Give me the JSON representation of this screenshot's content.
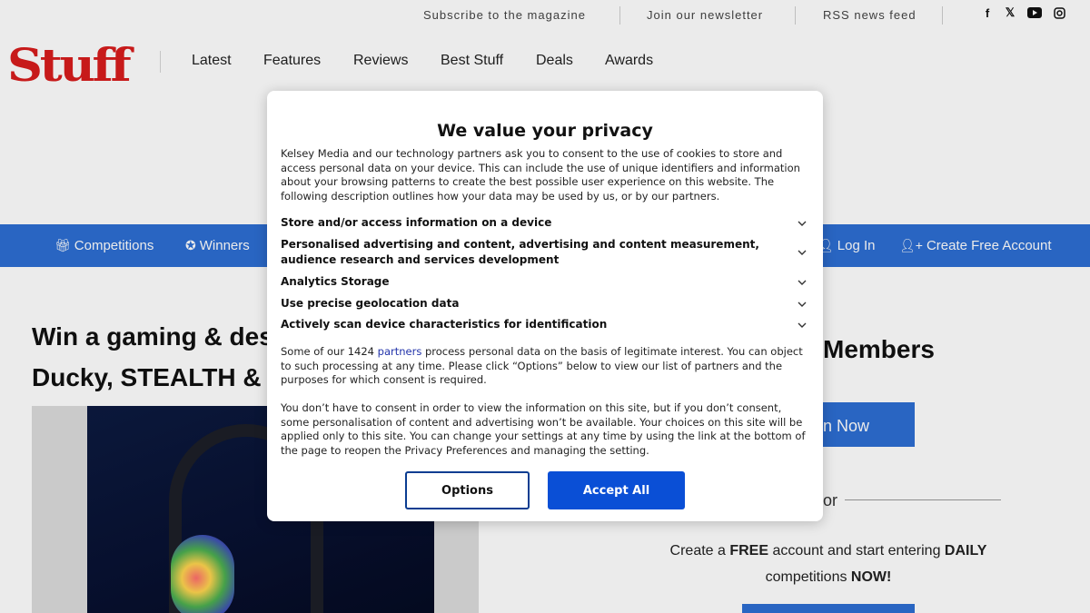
{
  "topbar": {
    "links": [
      "Subscribe to the magazine",
      "Join our newsletter",
      "RSS news feed"
    ],
    "social_icons": [
      "facebook-icon",
      "x-icon",
      "youtube-icon",
      "instagram-icon"
    ]
  },
  "logo": {
    "text": "Stuff"
  },
  "main_nav": [
    "Latest",
    "Features",
    "Reviews",
    "Best Stuff",
    "Deals",
    "Awards"
  ],
  "blue_nav": {
    "competitions": "Competitions",
    "winners": "Winners",
    "login": "Log In",
    "create_account": "Create Free Account"
  },
  "article": {
    "title": "Win a gaming & desk setup with Sennheiser, Ducky, STEALTH & Styletek"
  },
  "members": {
    "title": "Members",
    "join_label": "n Now",
    "or": "or",
    "promo_prefix": "Create a ",
    "promo_free": "FREE",
    "promo_middle": " account and start entering ",
    "promo_daily": "DAILY",
    "promo_suffix_a": " competitions ",
    "promo_now": "NOW!"
  },
  "dialog": {
    "title": "We value your privacy",
    "intro": "Kelsey Media and our technology partners ask you to consent to the use of cookies to store and access personal data on your device. This can include the use of unique identifiers and information about your browsing patterns to create the best possible user experience on this website. The following description outlines how your data may be used by us, or by our partners.",
    "purposes": [
      "Store and/or access information on a device",
      "Personalised advertising and content, advertising and content measurement, audience research and services development",
      "Analytics Storage",
      "Use precise geolocation data",
      "Actively scan device characteristics for identification"
    ],
    "legit_prefix": "Some of our 1424 ",
    "legit_link": "partners",
    "legit_suffix": " process personal data on the basis of legitimate interest. You can object to such processing at any time. Please click “Options” below to view our list of partners and the purposes for which consent is required.",
    "consent_text": "You don’t have to consent in order to view the information on this site, but if you don’t consent, some personalisation of content and advertising won’t be available. Your choices on this site will be applied only to this site. You can change your settings at any time by using the link at the bottom of the page to reopen the Privacy Preferences and managing the setting.",
    "options_label": "Options",
    "accept_label": "Accept All"
  },
  "colors": {
    "brand_red": "#d81d1d",
    "nav_blue": "#2d6ed3",
    "accept_blue": "#0a4fd6",
    "options_border": "#0a3d91"
  }
}
